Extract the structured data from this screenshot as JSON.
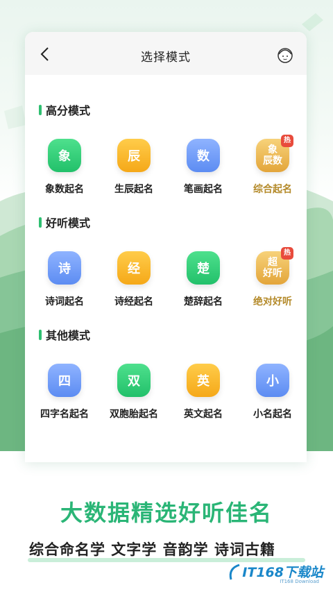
{
  "nav": {
    "title": "选择模式"
  },
  "sections": [
    {
      "title": "高分模式",
      "items": [
        {
          "glyph": "象",
          "label": "象数起名",
          "color": "green"
        },
        {
          "glyph": "辰",
          "label": "生辰起名",
          "color": "orange"
        },
        {
          "glyph": "数",
          "label": "笔画起名",
          "color": "blue"
        },
        {
          "glyph1": "象",
          "glyph2": "辰数",
          "label": "综合起名",
          "color": "gold",
          "badge": "热"
        }
      ]
    },
    {
      "title": "好听模式",
      "items": [
        {
          "glyph": "诗",
          "label": "诗词起名",
          "color": "blue"
        },
        {
          "glyph": "经",
          "label": "诗经起名",
          "color": "orange"
        },
        {
          "glyph": "楚",
          "label": "楚辞起名",
          "color": "green"
        },
        {
          "glyph1": "超",
          "glyph2": "好听",
          "label": "绝对好听",
          "color": "gold",
          "badge": "热"
        }
      ]
    },
    {
      "title": "其他模式",
      "items": [
        {
          "glyph": "四",
          "label": "四字名起名",
          "color": "blue"
        },
        {
          "glyph": "双",
          "label": "双胞胎起名",
          "color": "green"
        },
        {
          "glyph": "英",
          "label": "英文起名",
          "color": "orange"
        },
        {
          "glyph": "小",
          "label": "小名起名",
          "color": "blue"
        }
      ]
    }
  ],
  "slogan": "大数据精选好听佳名",
  "tags": "综合命名学  文字学  音韵学  诗词古籍",
  "watermark": {
    "text": "IT168下载站",
    "sub": "IT168 Download"
  },
  "colors": {
    "accent": "#2fbf71",
    "gold_text": "#b48a2a",
    "hot_badge": "#e84b3c"
  }
}
